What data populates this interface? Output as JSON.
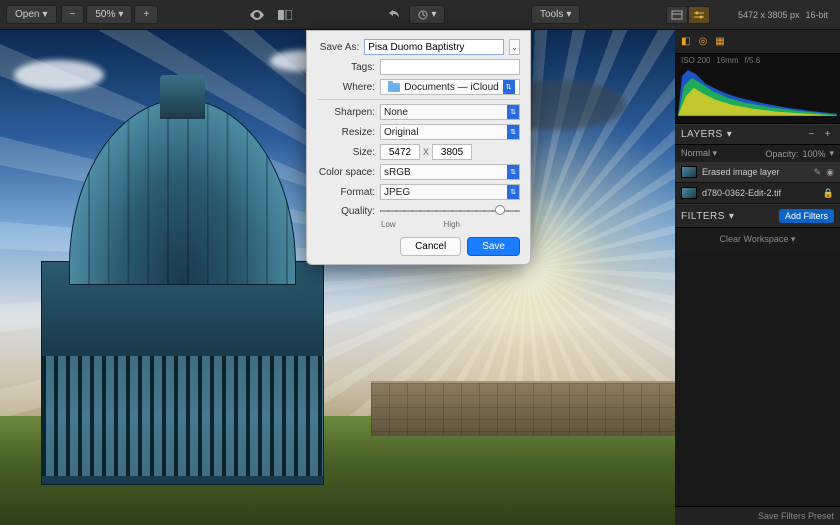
{
  "toolbar": {
    "open_label": "Open",
    "zoom_pct": "50%",
    "tools_label": "Tools"
  },
  "info": {
    "dimensions": "5472 x 3805 px",
    "bits": "16-bit",
    "iso": "ISO 200",
    "focal": "16mm",
    "aperture": "f/5.6"
  },
  "layers": {
    "header": "LAYERS",
    "blend_mode": "Normal",
    "opacity_label": "Opacity:",
    "opacity_value": "100%",
    "items": [
      {
        "name": "Erased image layer"
      },
      {
        "name": "d780-0362-Edit-2.tif"
      }
    ]
  },
  "filters": {
    "header": "FILTERS",
    "add_label": "Add Filters",
    "clear_label": "Clear Workspace",
    "save_preset": "Save Filters Preset"
  },
  "dialog": {
    "save_as_label": "Save As:",
    "save_as_value": "Pisa Duomo Baptistry",
    "tags_label": "Tags:",
    "tags_value": "",
    "where_label": "Where:",
    "where_value": "Documents — iCloud",
    "sharpen_label": "Sharpen:",
    "sharpen_value": "None",
    "resize_label": "Resize:",
    "resize_value": "Original",
    "size_label": "Size:",
    "size_w": "5472",
    "size_x": "X",
    "size_h": "3805",
    "colorspace_label": "Color space:",
    "colorspace_value": "sRGB",
    "format_label": "Format:",
    "format_value": "JPEG",
    "quality_label": "Quality:",
    "quality_low": "Low",
    "quality_high": "High",
    "cancel": "Cancel",
    "save": "Save"
  }
}
